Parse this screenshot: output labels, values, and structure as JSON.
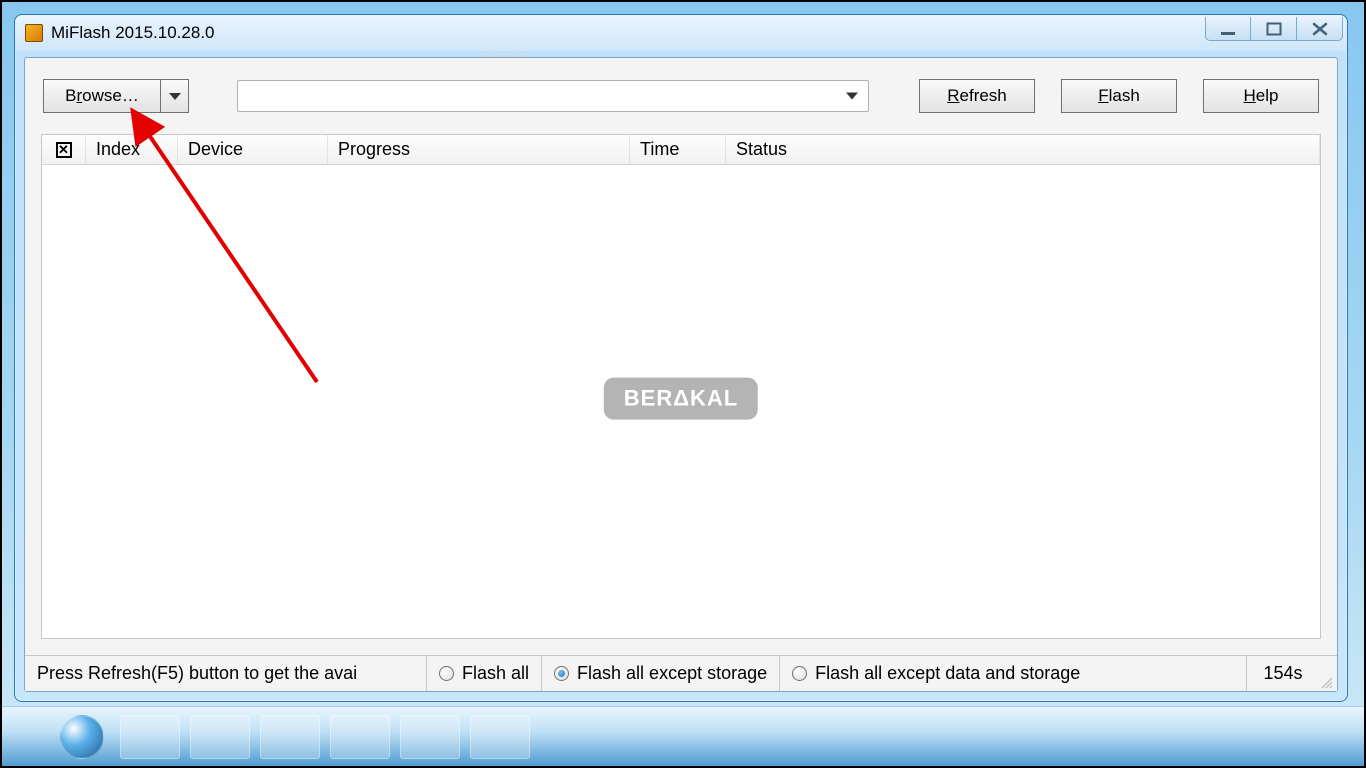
{
  "window": {
    "title": "MiFlash 2015.10.28.0"
  },
  "toolbar": {
    "browse_label": "Browse…",
    "path_value": "",
    "refresh_label": "Refresh",
    "flash_label": "Flash",
    "help_label": "Help"
  },
  "list": {
    "columns": {
      "index": "Index",
      "device": "Device",
      "progress": "Progress",
      "time": "Time",
      "status": "Status"
    },
    "rows": []
  },
  "watermark": "BERΔKAL",
  "statusbar": {
    "hint": "Press Refresh(F5) button to get the avai",
    "options": {
      "flash_all": "Flash all",
      "flash_except_storage": "Flash all except storage",
      "flash_except_data_storage": "Flash all except data and storage"
    },
    "selected_option": "flash_except_storage",
    "elapsed": "154s"
  }
}
